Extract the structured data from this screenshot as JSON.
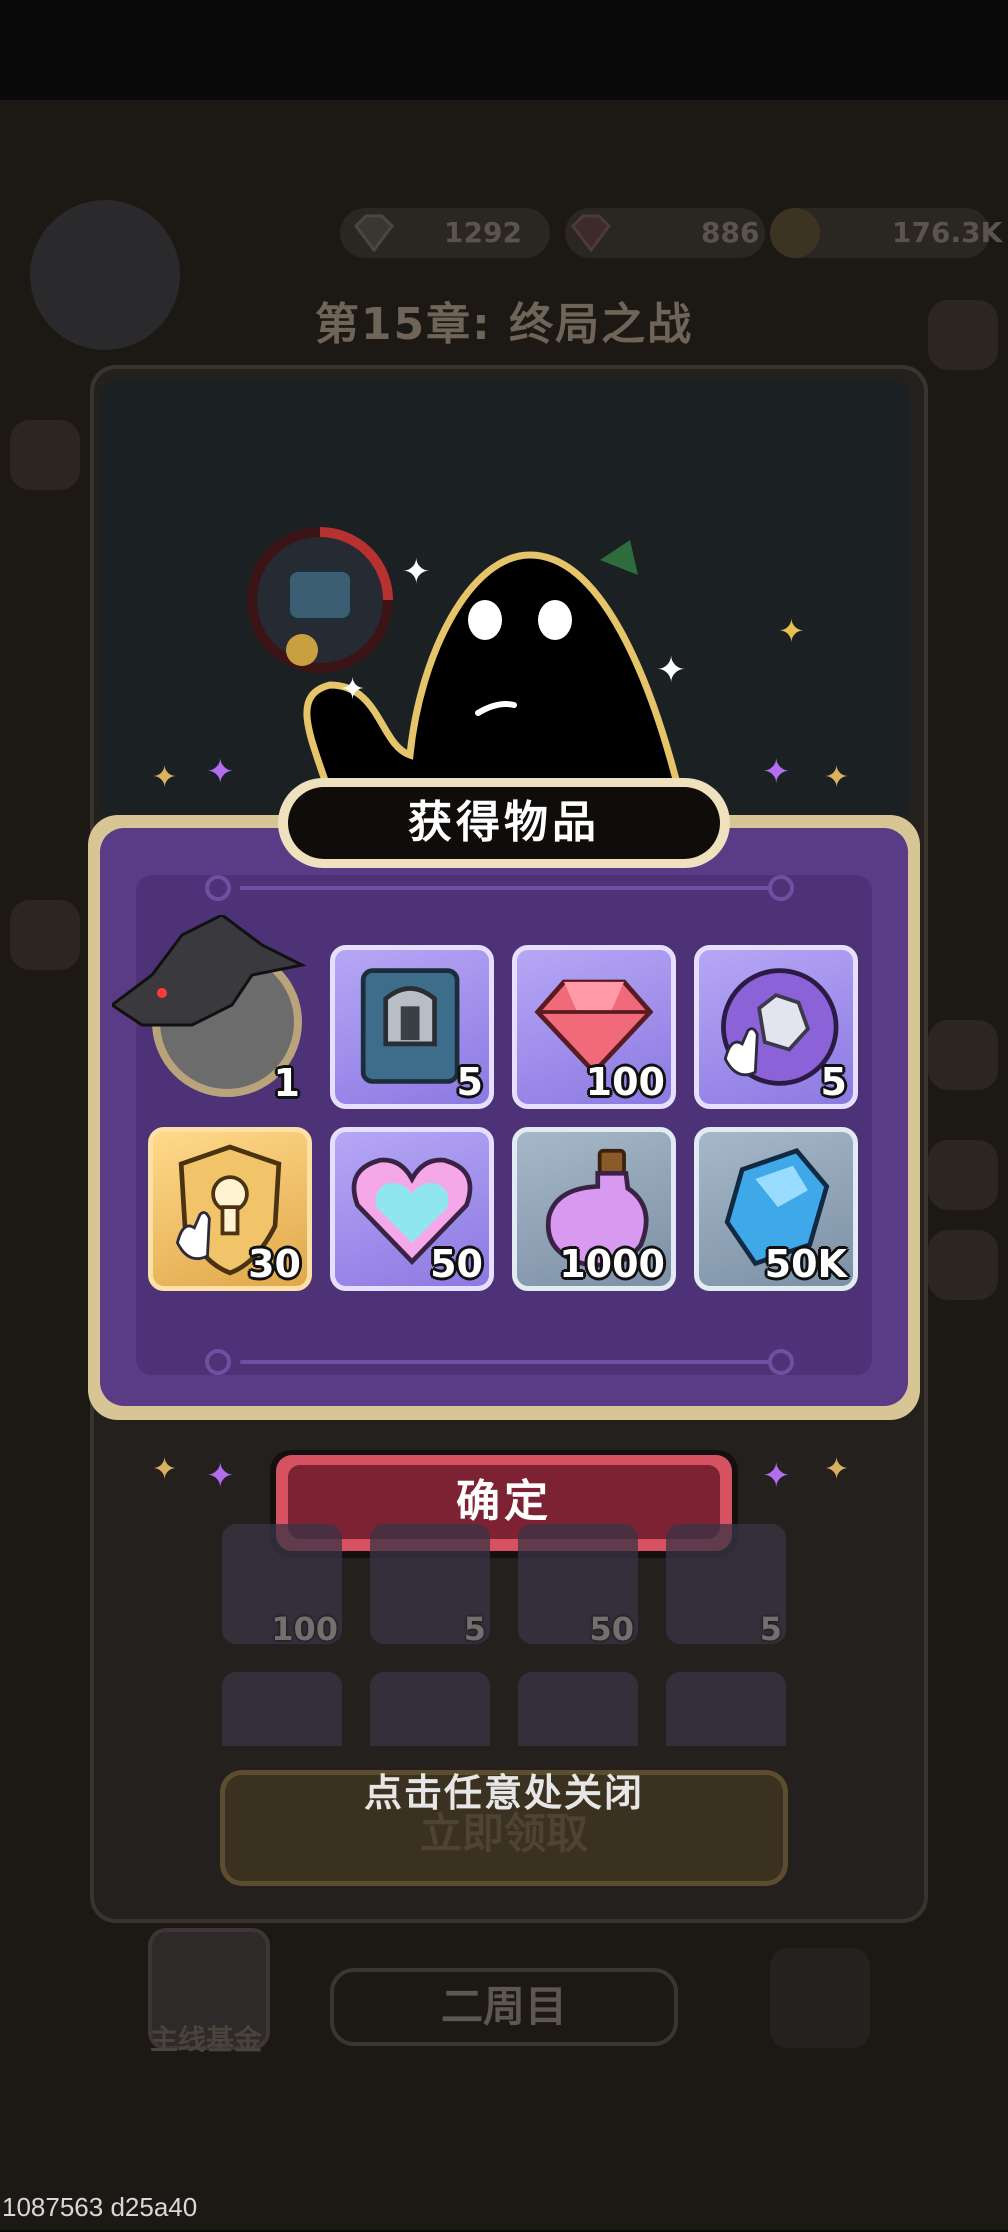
{
  "topbar": {
    "gem_count": "1292",
    "ruby_count": "886",
    "gold_count": "176.3K"
  },
  "chapter_title": "第15章: 终局之战",
  "dialog": {
    "title": "获得物品",
    "confirm_label": "确定",
    "rewards": [
      {
        "icon": "wolf-avatar-frame-icon",
        "count": "1"
      },
      {
        "icon": "helmet-book-icon",
        "count": "5"
      },
      {
        "icon": "red-gem-icon",
        "count": "100"
      },
      {
        "icon": "armor-orb-icon",
        "count": "5"
      },
      {
        "icon": "gold-keyhole-shield-icon",
        "count": "30"
      },
      {
        "icon": "heart-crystal-icon",
        "count": "50"
      },
      {
        "icon": "purple-potion-icon",
        "count": "1000"
      },
      {
        "icon": "blue-crystal-icon",
        "count": "50K"
      }
    ]
  },
  "background_preview": {
    "rewards": [
      {
        "icon": "red-gem-icon",
        "count": "100"
      },
      {
        "icon": "helmet-book-icon",
        "count": "5"
      },
      {
        "icon": "heart-crystal-icon",
        "count": "50"
      },
      {
        "icon": "armor-orb-icon",
        "count": "5"
      }
    ],
    "claim_label": "立即领取"
  },
  "close_hint": "点击任意处关闭",
  "bottom": {
    "fund_label": "主线基金",
    "second_round_label": "二周目"
  },
  "debug_label": "1087563 d25a40",
  "colors": {
    "dialog_purple": "#5a3b86",
    "confirm_red": "#d65261",
    "frame_gold": "#d8c596"
  }
}
